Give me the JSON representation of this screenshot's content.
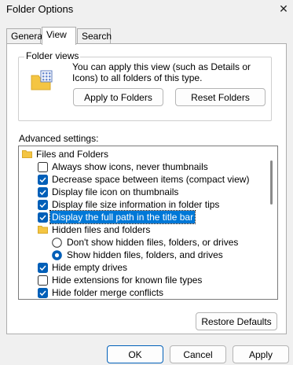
{
  "window": {
    "title": "Folder Options",
    "close_glyph": "✕"
  },
  "tabs": [
    {
      "label": "General",
      "active": false
    },
    {
      "label": "View",
      "active": true
    },
    {
      "label": "Search",
      "active": false
    }
  ],
  "folder_views": {
    "group_label": "Folder views",
    "description": "You can apply this view (such as Details or Icons) to all folders of this type.",
    "apply_label": "Apply to Folders",
    "reset_label": "Reset Folders"
  },
  "advanced": {
    "label": "Advanced settings:",
    "items": [
      {
        "type": "folder",
        "level": 0,
        "label": "Files and Folders"
      },
      {
        "type": "checkbox",
        "level": 1,
        "checked": false,
        "label": "Always show icons, never thumbnails"
      },
      {
        "type": "checkbox",
        "level": 1,
        "checked": true,
        "label": "Decrease space between items (compact view)"
      },
      {
        "type": "checkbox",
        "level": 1,
        "checked": true,
        "label": "Display file icon on thumbnails"
      },
      {
        "type": "checkbox",
        "level": 1,
        "checked": true,
        "label": "Display file size information in folder tips"
      },
      {
        "type": "checkbox",
        "level": 1,
        "checked": true,
        "label": "Display the full path in the title bar",
        "selected": true
      },
      {
        "type": "folder",
        "level": 1,
        "label": "Hidden files and folders"
      },
      {
        "type": "radio",
        "level": 2,
        "checked": false,
        "label": "Don't show hidden files, folders, or drives"
      },
      {
        "type": "radio",
        "level": 2,
        "checked": true,
        "label": "Show hidden files, folders, and drives"
      },
      {
        "type": "checkbox",
        "level": 1,
        "checked": true,
        "label": "Hide empty drives"
      },
      {
        "type": "checkbox",
        "level": 1,
        "checked": false,
        "label": "Hide extensions for known file types"
      },
      {
        "type": "checkbox",
        "level": 1,
        "checked": true,
        "label": "Hide folder merge conflicts"
      }
    ],
    "restore_label": "Restore Defaults"
  },
  "footer": {
    "ok_label": "OK",
    "cancel_label": "Cancel",
    "apply_label": "Apply"
  },
  "colors": {
    "accent": "#005fb8",
    "selection": "#0078d7",
    "folder": "#f4c542"
  }
}
